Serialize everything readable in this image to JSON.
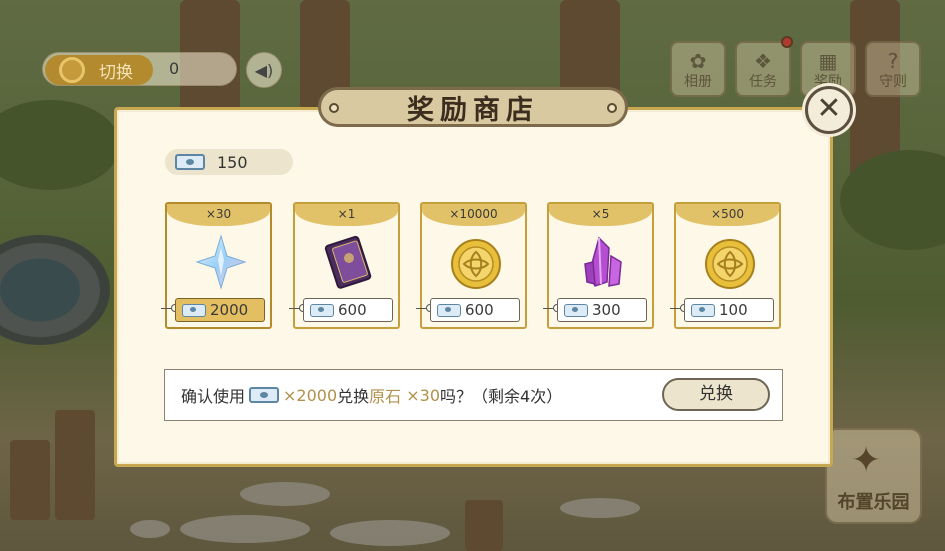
{
  "hud": {
    "switch_label": "切换",
    "coin_value": "0",
    "menu": [
      {
        "label": "相册",
        "glyph": "✿"
      },
      {
        "label": "任务",
        "glyph": "❖"
      },
      {
        "label": "奖励",
        "glyph": "▦"
      },
      {
        "label": "守则",
        "glyph": "?"
      }
    ],
    "arrange_label": "布置乐园",
    "sound_glyph": "◀)"
  },
  "shop": {
    "title": "奖励商店",
    "close_glyph": "✕",
    "ticket_balance": "150",
    "items": [
      {
        "qty": "×30",
        "price": "2000",
        "icon": "primogem-icon",
        "selected": true
      },
      {
        "qty": "×1",
        "price": "600",
        "icon": "book-icon",
        "selected": false
      },
      {
        "qty": "×10000",
        "price": "600",
        "icon": "mora-coin-icon",
        "selected": false
      },
      {
        "qty": "×5",
        "price": "300",
        "icon": "purple-crystal-icon",
        "selected": false
      },
      {
        "qty": "×500",
        "price": "100",
        "icon": "mora-coin-icon",
        "selected": false
      }
    ],
    "confirm": {
      "prefix": "确认使用",
      "cost": "×2000",
      "middle": "兑换",
      "item_name": "原石",
      "item_qty": " ×30",
      "suffix": "吗？（剩余4次）",
      "button_label": "兑换"
    }
  },
  "colors": {
    "accent_gold": "#c69f3c",
    "ticket_blue": "#5d86a4",
    "accent_text": "#b0904a"
  }
}
